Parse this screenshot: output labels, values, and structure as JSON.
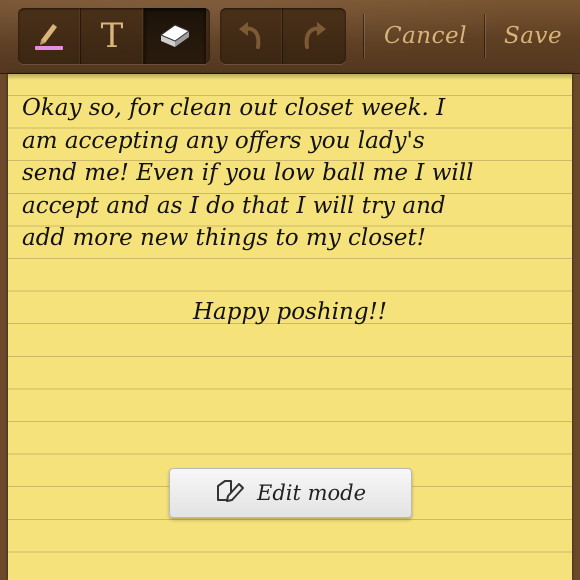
{
  "toolbar": {
    "tools": [
      {
        "name": "pen",
        "icon": "pen-icon",
        "active": false
      },
      {
        "name": "text",
        "icon": "text-tool-icon",
        "glyph": "T",
        "active": false
      },
      {
        "name": "eraser",
        "icon": "eraser-icon",
        "active": true
      }
    ],
    "history": [
      {
        "name": "undo",
        "icon": "undo-icon"
      },
      {
        "name": "redo",
        "icon": "redo-icon"
      }
    ],
    "cancel_label": "Cancel",
    "save_label": "Save",
    "accent_color": "#d8b47a",
    "pen_color": "#e78ee0"
  },
  "note": {
    "lines": [
      "Okay so, for clean out closet week. I",
      "am accepting any offers you lady's",
      "send me! Even if you low ball me I will",
      "accept and as I do that I will try and",
      "add more new things to my closet!"
    ],
    "closing": "Happy poshing!!",
    "paper_color": "#f6e27a"
  },
  "edit_mode": {
    "label": "Edit mode",
    "icon": "edit-mode-icon"
  }
}
